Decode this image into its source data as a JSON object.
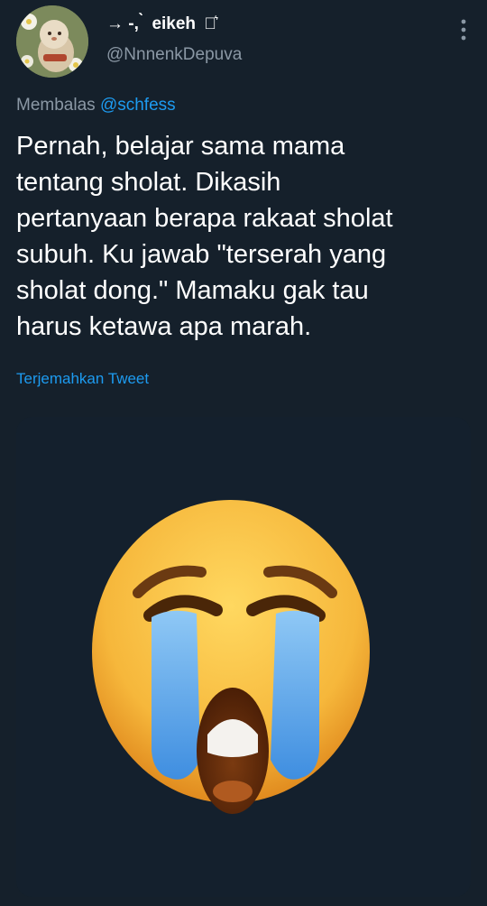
{
  "tweet": {
    "author": {
      "ornament": "→ -, ̀",
      "display_name": "eikeh",
      "name_suffix": "≋͛",
      "handle": "@NnnenkDepuva"
    },
    "reply_prefix": "Membalas",
    "reply_to": "@schfess",
    "text": "Pernah, belajar sama mama\ntentang sholat. Dikasih\npertanyaan berapa rakaat sholat\nsubuh. Ku jawab \"terserah yang\nsholat dong.\" Mamaku gak tau\nharus ketawa apa marah.",
    "translate_label": "Terjemahkan Tweet",
    "media": {
      "description_icon": "loudly-crying-face-emoji"
    }
  },
  "colors": {
    "background": "#15202b",
    "text_primary": "#ffffff",
    "text_secondary": "#8b98a5",
    "link": "#1d9bf0",
    "media_bg": "#14202d",
    "emoji_face": "#f6b73b",
    "emoji_tears": "#5aa3e8"
  },
  "icons": {
    "more": "more-vertical-icon",
    "avatar": "avatar-image"
  }
}
